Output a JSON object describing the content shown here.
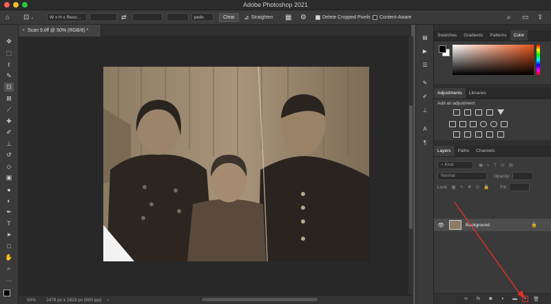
{
  "app": {
    "title": "Adobe Photoshop 2021"
  },
  "options_bar": {
    "ratio_select": "W x H x Reso...",
    "units": "px/in",
    "clear_label": "Clear",
    "straighten_label": "Straighten",
    "delete_cropped_label": "Delete Cropped Pixels",
    "delete_cropped_checked": true,
    "content_aware_label": "Content-Aware",
    "content_aware_checked": false
  },
  "document": {
    "tab_label": "Scan 9.tiff @ 50% (RGB/8) *"
  },
  "status": {
    "zoom": "50%",
    "info": "2478 px x 1823 px (600 ppi)"
  },
  "panels": {
    "color_tabs": [
      "Swatches",
      "Gradients",
      "Patterns",
      "Color"
    ],
    "color_active": "Color",
    "adjust_tabs": [
      "Adjustments",
      "Libraries"
    ],
    "adjust_active": "Adjustments",
    "add_adjustment": "Add an adjustment",
    "layers_tabs": [
      "Layers",
      "Paths",
      "Channels"
    ],
    "layers_active": "Layers",
    "kind_label": "Kind",
    "blend_mode": "Normal",
    "opacity_label": "Opacity:",
    "lock_label": "Lock:",
    "fill_label": "Fill:",
    "layer_name": "Background"
  },
  "colors": {
    "annotation_arrow": "#e0302a",
    "accent_hue": "#e8541a"
  }
}
